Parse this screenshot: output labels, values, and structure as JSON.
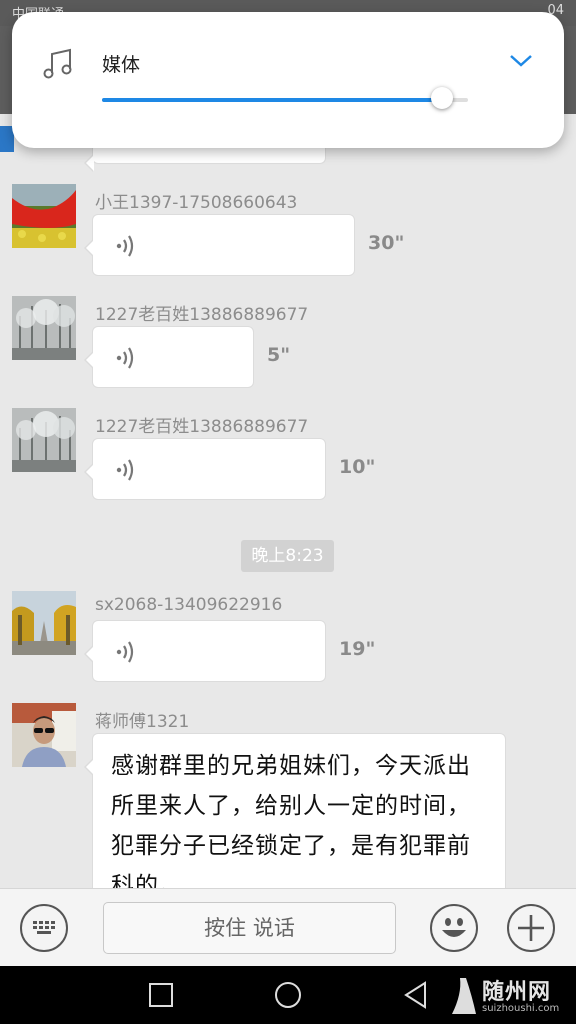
{
  "status_bar": {
    "carrier": "中国联通",
    "clock": "04"
  },
  "volume_panel": {
    "icon": "music-note-icon",
    "label": "媒体",
    "level": 0.93,
    "accent": "#1e88e5"
  },
  "messages": [
    {
      "sender": "小王1397-17508660643",
      "type": "voice",
      "duration": "30\"",
      "avatar": "red-flower-bed-photo"
    },
    {
      "sender": "1227老百姓13886889677",
      "type": "voice",
      "duration": "5\"",
      "avatar": "snowy-trees-photo"
    },
    {
      "sender": "1227老百姓13886889677",
      "type": "voice",
      "duration": "10\"",
      "avatar": "snowy-trees-photo"
    },
    {
      "sender": "sx2068-13409622916",
      "type": "voice",
      "duration": "19\"",
      "avatar": "autumn-avenue-photo"
    },
    {
      "sender": "蒋师傅1321",
      "type": "text",
      "text": "感谢群里的兄弟姐妹们，今天派出所里来人了，给别人一定的时间，犯罪分子已经锁定了，是有犯罪前科的。",
      "avatar": "man-with-sunglasses-photo"
    }
  ],
  "time_divider": "晚上8:23",
  "input_bar": {
    "keyboard_icon": "keyboard-icon",
    "talk_button": "按住 说话",
    "emoji_icon": "emoji-smile-icon",
    "plus_icon": "plus-icon"
  },
  "nav_bar": {
    "recent_icon": "square-icon",
    "home_icon": "circle-icon",
    "back_icon": "triangle-back-icon"
  },
  "watermark": {
    "title": "随州网",
    "subtitle": "suizhoushi.com"
  }
}
